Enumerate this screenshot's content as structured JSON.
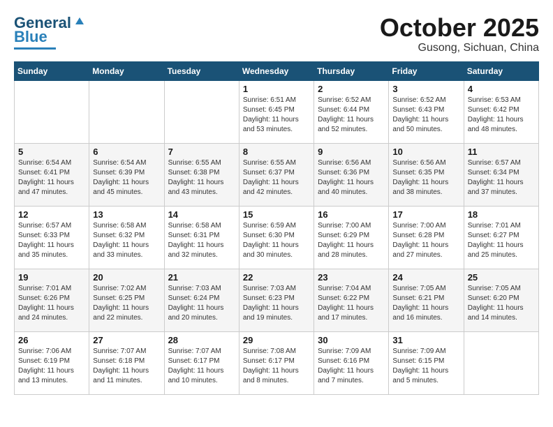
{
  "header": {
    "logo_general": "General",
    "logo_blue": "Blue",
    "month": "October 2025",
    "location": "Gusong, Sichuan, China"
  },
  "weekdays": [
    "Sunday",
    "Monday",
    "Tuesday",
    "Wednesday",
    "Thursday",
    "Friday",
    "Saturday"
  ],
  "weeks": [
    [
      {
        "day": "",
        "info": ""
      },
      {
        "day": "",
        "info": ""
      },
      {
        "day": "",
        "info": ""
      },
      {
        "day": "1",
        "info": "Sunrise: 6:51 AM\nSunset: 6:45 PM\nDaylight: 11 hours and 53 minutes."
      },
      {
        "day": "2",
        "info": "Sunrise: 6:52 AM\nSunset: 6:44 PM\nDaylight: 11 hours and 52 minutes."
      },
      {
        "day": "3",
        "info": "Sunrise: 6:52 AM\nSunset: 6:43 PM\nDaylight: 11 hours and 50 minutes."
      },
      {
        "day": "4",
        "info": "Sunrise: 6:53 AM\nSunset: 6:42 PM\nDaylight: 11 hours and 48 minutes."
      }
    ],
    [
      {
        "day": "5",
        "info": "Sunrise: 6:54 AM\nSunset: 6:41 PM\nDaylight: 11 hours and 47 minutes."
      },
      {
        "day": "6",
        "info": "Sunrise: 6:54 AM\nSunset: 6:39 PM\nDaylight: 11 hours and 45 minutes."
      },
      {
        "day": "7",
        "info": "Sunrise: 6:55 AM\nSunset: 6:38 PM\nDaylight: 11 hours and 43 minutes."
      },
      {
        "day": "8",
        "info": "Sunrise: 6:55 AM\nSunset: 6:37 PM\nDaylight: 11 hours and 42 minutes."
      },
      {
        "day": "9",
        "info": "Sunrise: 6:56 AM\nSunset: 6:36 PM\nDaylight: 11 hours and 40 minutes."
      },
      {
        "day": "10",
        "info": "Sunrise: 6:56 AM\nSunset: 6:35 PM\nDaylight: 11 hours and 38 minutes."
      },
      {
        "day": "11",
        "info": "Sunrise: 6:57 AM\nSunset: 6:34 PM\nDaylight: 11 hours and 37 minutes."
      }
    ],
    [
      {
        "day": "12",
        "info": "Sunrise: 6:57 AM\nSunset: 6:33 PM\nDaylight: 11 hours and 35 minutes."
      },
      {
        "day": "13",
        "info": "Sunrise: 6:58 AM\nSunset: 6:32 PM\nDaylight: 11 hours and 33 minutes."
      },
      {
        "day": "14",
        "info": "Sunrise: 6:58 AM\nSunset: 6:31 PM\nDaylight: 11 hours and 32 minutes."
      },
      {
        "day": "15",
        "info": "Sunrise: 6:59 AM\nSunset: 6:30 PM\nDaylight: 11 hours and 30 minutes."
      },
      {
        "day": "16",
        "info": "Sunrise: 7:00 AM\nSunset: 6:29 PM\nDaylight: 11 hours and 28 minutes."
      },
      {
        "day": "17",
        "info": "Sunrise: 7:00 AM\nSunset: 6:28 PM\nDaylight: 11 hours and 27 minutes."
      },
      {
        "day": "18",
        "info": "Sunrise: 7:01 AM\nSunset: 6:27 PM\nDaylight: 11 hours and 25 minutes."
      }
    ],
    [
      {
        "day": "19",
        "info": "Sunrise: 7:01 AM\nSunset: 6:26 PM\nDaylight: 11 hours and 24 minutes."
      },
      {
        "day": "20",
        "info": "Sunrise: 7:02 AM\nSunset: 6:25 PM\nDaylight: 11 hours and 22 minutes."
      },
      {
        "day": "21",
        "info": "Sunrise: 7:03 AM\nSunset: 6:24 PM\nDaylight: 11 hours and 20 minutes."
      },
      {
        "day": "22",
        "info": "Sunrise: 7:03 AM\nSunset: 6:23 PM\nDaylight: 11 hours and 19 minutes."
      },
      {
        "day": "23",
        "info": "Sunrise: 7:04 AM\nSunset: 6:22 PM\nDaylight: 11 hours and 17 minutes."
      },
      {
        "day": "24",
        "info": "Sunrise: 7:05 AM\nSunset: 6:21 PM\nDaylight: 11 hours and 16 minutes."
      },
      {
        "day": "25",
        "info": "Sunrise: 7:05 AM\nSunset: 6:20 PM\nDaylight: 11 hours and 14 minutes."
      }
    ],
    [
      {
        "day": "26",
        "info": "Sunrise: 7:06 AM\nSunset: 6:19 PM\nDaylight: 11 hours and 13 minutes."
      },
      {
        "day": "27",
        "info": "Sunrise: 7:07 AM\nSunset: 6:18 PM\nDaylight: 11 hours and 11 minutes."
      },
      {
        "day": "28",
        "info": "Sunrise: 7:07 AM\nSunset: 6:17 PM\nDaylight: 11 hours and 10 minutes."
      },
      {
        "day": "29",
        "info": "Sunrise: 7:08 AM\nSunset: 6:17 PM\nDaylight: 11 hours and 8 minutes."
      },
      {
        "day": "30",
        "info": "Sunrise: 7:09 AM\nSunset: 6:16 PM\nDaylight: 11 hours and 7 minutes."
      },
      {
        "day": "31",
        "info": "Sunrise: 7:09 AM\nSunset: 6:15 PM\nDaylight: 11 hours and 5 minutes."
      },
      {
        "day": "",
        "info": ""
      }
    ]
  ]
}
